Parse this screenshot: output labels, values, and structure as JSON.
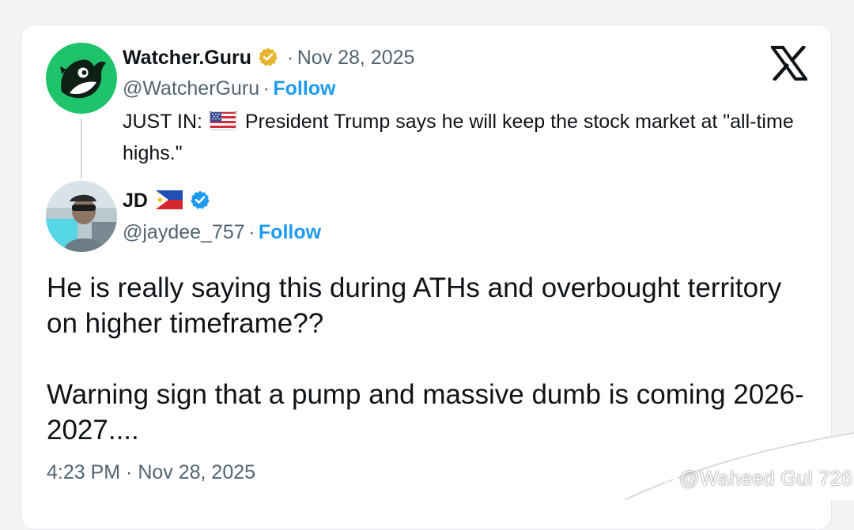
{
  "quoted_post": {
    "author_name": "Watcher.Guru",
    "date": "Nov 28, 2025",
    "handle": "@WatcherGuru",
    "follow_label": "Follow",
    "text_prefix": "JUST IN:",
    "text_body": "President Trump says he will keep the stock market at \"all-time highs.\"",
    "flag_icon": "us-flag-icon",
    "verified_badge": "gold-verified-badge-icon",
    "avatar_colors": {
      "background": "#1fc46a",
      "whale": "#0e1f16"
    }
  },
  "post": {
    "author_name": "JD",
    "flag_icon": "philippines-flag-icon",
    "verified_badge": "blue-verified-badge-icon",
    "handle": "@jaydee_757",
    "follow_label": "Follow",
    "paragraphs": [
      "He is really saying this during ATHs and overbought territory on higher timeframe??",
      "Warning sign that a pump and massive dumb is coming 2026-2027...."
    ],
    "timestamp": "4:23 PM · Nov 28, 2025"
  },
  "x_logo": "x-logo-icon",
  "watermark": "@Waheed Gul 726",
  "colors": {
    "link_blue": "#1d9bf0",
    "text_primary": "#0f1419",
    "text_secondary": "#536471",
    "gold_badge": "#e8b52f",
    "blue_badge": "#1d9bf0"
  }
}
